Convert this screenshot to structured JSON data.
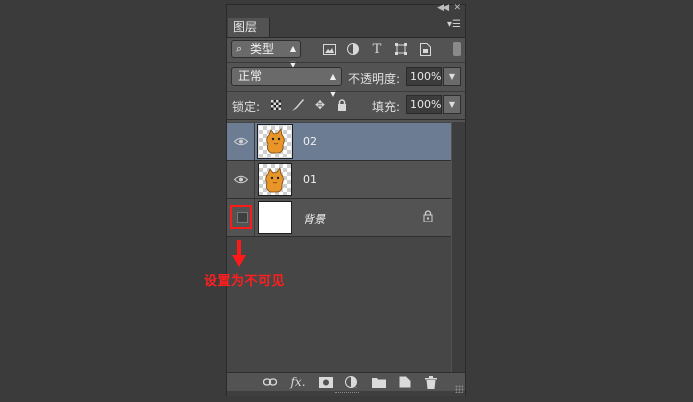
{
  "panel": {
    "tab_label": "图层",
    "menu_icon": "panel-menu-icon",
    "collapse_icon": "collapse-icon"
  },
  "filter": {
    "kind_label": "类型",
    "icons": [
      "image-filter-icon",
      "adjustment-filter-icon",
      "type-filter-icon",
      "shape-filter-icon",
      "smart-object-filter-icon"
    ],
    "type_glyph": "T"
  },
  "blend": {
    "mode": "正常",
    "opacity_label": "不透明度:",
    "opacity_value": "100%"
  },
  "lock": {
    "label": "锁定:",
    "fill_label": "填充:",
    "fill_value": "100%"
  },
  "layers": [
    {
      "name": "02",
      "selected": true,
      "visible": true
    },
    {
      "name": "01",
      "selected": false,
      "visible": true
    },
    {
      "name": "背景",
      "selected": false,
      "visible": false,
      "locked": true
    }
  ],
  "annotation": {
    "text": "设置为不可见",
    "color": "#ff1a1a"
  },
  "bottom_icons": [
    "link-icon",
    "fx-icon",
    "mask-icon",
    "adjustment-layer-icon",
    "folder-icon",
    "new-layer-icon",
    "trash-icon"
  ],
  "colors": {
    "panel_bg": "#535353",
    "selected_row": "#6c7c92",
    "page_bg": "#3b3b3b"
  }
}
